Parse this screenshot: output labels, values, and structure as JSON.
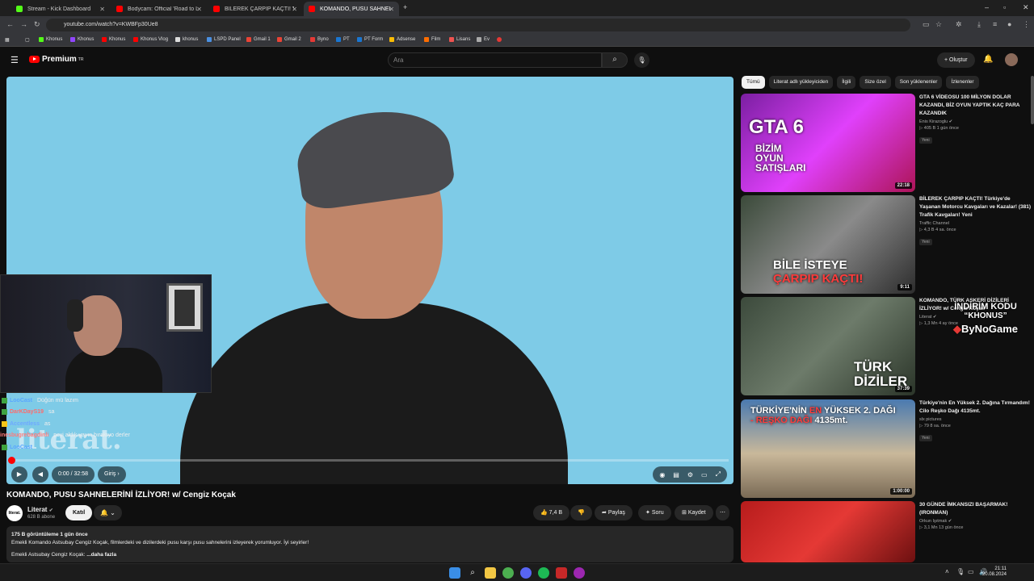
{
  "browser": {
    "tabs": [
      {
        "title": "Stream - Kick Dashboard",
        "color": "#53fc18"
      },
      {
        "title": "Bodycam: Official 'Road to Lock'",
        "color": "#ff0000"
      },
      {
        "title": "BİLEREK ÇARPIP KAÇTI! Türkiye'",
        "color": "#ff0000"
      },
      {
        "title": "KOMANDO, PUSU SAHNELERİNİ",
        "color": "#ff0000"
      }
    ],
    "url": "youtube.com/watch?v=KWBFp30Ue8",
    "bookmarks": [
      "Khonus",
      "Khonus",
      "Khonus",
      "Khonus Vlog",
      "khonus",
      "LSPD Panel",
      "Gmail 1",
      "Gmail 2",
      "Byno",
      "PT",
      "PT Form",
      "Adsense",
      "Film",
      "Lisans",
      "Ev"
    ]
  },
  "youtube": {
    "brand": "Premium",
    "brand_sup": "TR",
    "search_placeholder": "Ara",
    "create_label": "+ Oluştur"
  },
  "player": {
    "time": "0:00 / 32:58",
    "chapter": "Giriş ›",
    "watermark": "literat.",
    "progress_fraction": 0.0
  },
  "chat": [
    {
      "user": "LooCast",
      "text": "Düğün mü lazım",
      "color": "#5aa6ff"
    },
    {
      "user": "DarKDayS19",
      "text": "sa",
      "color": "#ff6b6b"
    },
    {
      "user": "Accentless",
      "text": "as",
      "color": "#6ea8ff"
    },
    {
      "user": "inesbugrebagdinli",
      "text": "pcyi aldık yayın bırakıyo derler",
      "color": "#ff7a7a"
    },
    {
      "user": "LooCast",
      "text": "",
      "color": "#5aa6ff"
    }
  ],
  "video": {
    "title": "KOMANDO, PUSU SAHNELERİNİ İZLİYOR! w/ Cengiz Koçak",
    "channel": "Literat",
    "channel_avatar_text": "literat.",
    "subscribers": "628 B abone",
    "join_label": "Katıl",
    "likes": "7,4 B",
    "share_label": "Paylaş",
    "ask_label": "Soru",
    "save_label": "Kaydet",
    "views_meta": "175 B görüntüleme  1 gün önce",
    "description_line1": "Emekli Komando Astsubay Cengiz Koçak, filmlerdeki ve dizilerdeki pusu karşı pusu sahnelerini izleyerek yorumluyor. İyi seyirler!",
    "description_line2": "Emekli Astsubay Cengiz Koçak:",
    "more_label": "...daha fazla"
  },
  "chips": [
    "Tümü",
    "Literat adlı yükleyiciden",
    "İlgili",
    "Size özel",
    "Son yüklenenler",
    "İzlenenler"
  ],
  "recommendations": [
    {
      "title": "GTA 6 VİDEOSU 100 MİLYON DOLAR KAZANDI, BİZ OYUN YAPTIK KAÇ PARA KAZANDIK",
      "channel": "Enis Kirazoglu ✔",
      "views": "▷ 405 B  1 gün önce",
      "badge": "Yeni",
      "duration": "22:18",
      "thumb_text": "GTA 6\nBİZİM OYUN SATIŞLARI",
      "bg": "linear-gradient(135deg,#7b1fa2,#e040fb 50%,#ad1457)"
    },
    {
      "title": "BİLEREK ÇARPIP KAÇTI! Türkiye'de Yaşanan Motorcu Kavgaları ve Kazalar! (381) Trafik Kavgaları! Yeni",
      "channel": "Traffic Channel",
      "views": "▷ 4,3 B  4 sa. önce",
      "badge": "Yeni",
      "duration": "9:11",
      "thumb_text": "BİLE İSTEYE ÇARPIP KAÇTI!",
      "bg": "linear-gradient(135deg,#3b4a3a,#8a8a8a 50%,#2d2d2d)"
    },
    {
      "title": "KOMANDO, TÜRK ASKERİ DİZİLERİ İZLİYOR! w/ Cengiz Koçak",
      "channel": "Literat ✔",
      "views": "▷ 1,3 Mn  4 ay önce",
      "badge": "",
      "duration": "37:39",
      "thumb_text": "TÜRK DİZİLER",
      "bg": "linear-gradient(135deg,#3c4a3c,#6d7b6a 50%,#2b3529)"
    },
    {
      "title": "Türkiye'nin En Yüksek 2. Dağına Tırmandım! Cilo Reşko Dağı 4135mt.",
      "channel": "slx pictures",
      "views": "▷ 79  8 sa. önce",
      "badge": "Yeni",
      "duration": "1:00:00",
      "thumb_text": "TÜRKİYE'NİN EN YÜKSEK 2. DAĞI - REŞKO DAĞI 4135mt.",
      "bg": "linear-gradient(180deg,#4a7ab0,#c9b89a 55%,#7a6a55)"
    },
    {
      "title": "30 GÜNDE İMKANSIZI BAŞARMAK! (IRONMAN)",
      "channel": "Orkun Işıtmak ✔",
      "views": "▷ 3,1 Mn  13 gün önce",
      "badge": "",
      "duration": "",
      "thumb_text": "",
      "bg": "linear-gradient(135deg,#b71c1c,#e53935 50%,#6d1010)"
    }
  ],
  "promo": {
    "line1": "İNDİRİM KODU",
    "line2": "“KHONUS”",
    "brand": "ByNoGame"
  },
  "clock": {
    "time": "21:11",
    "date": "20.08.2024"
  }
}
